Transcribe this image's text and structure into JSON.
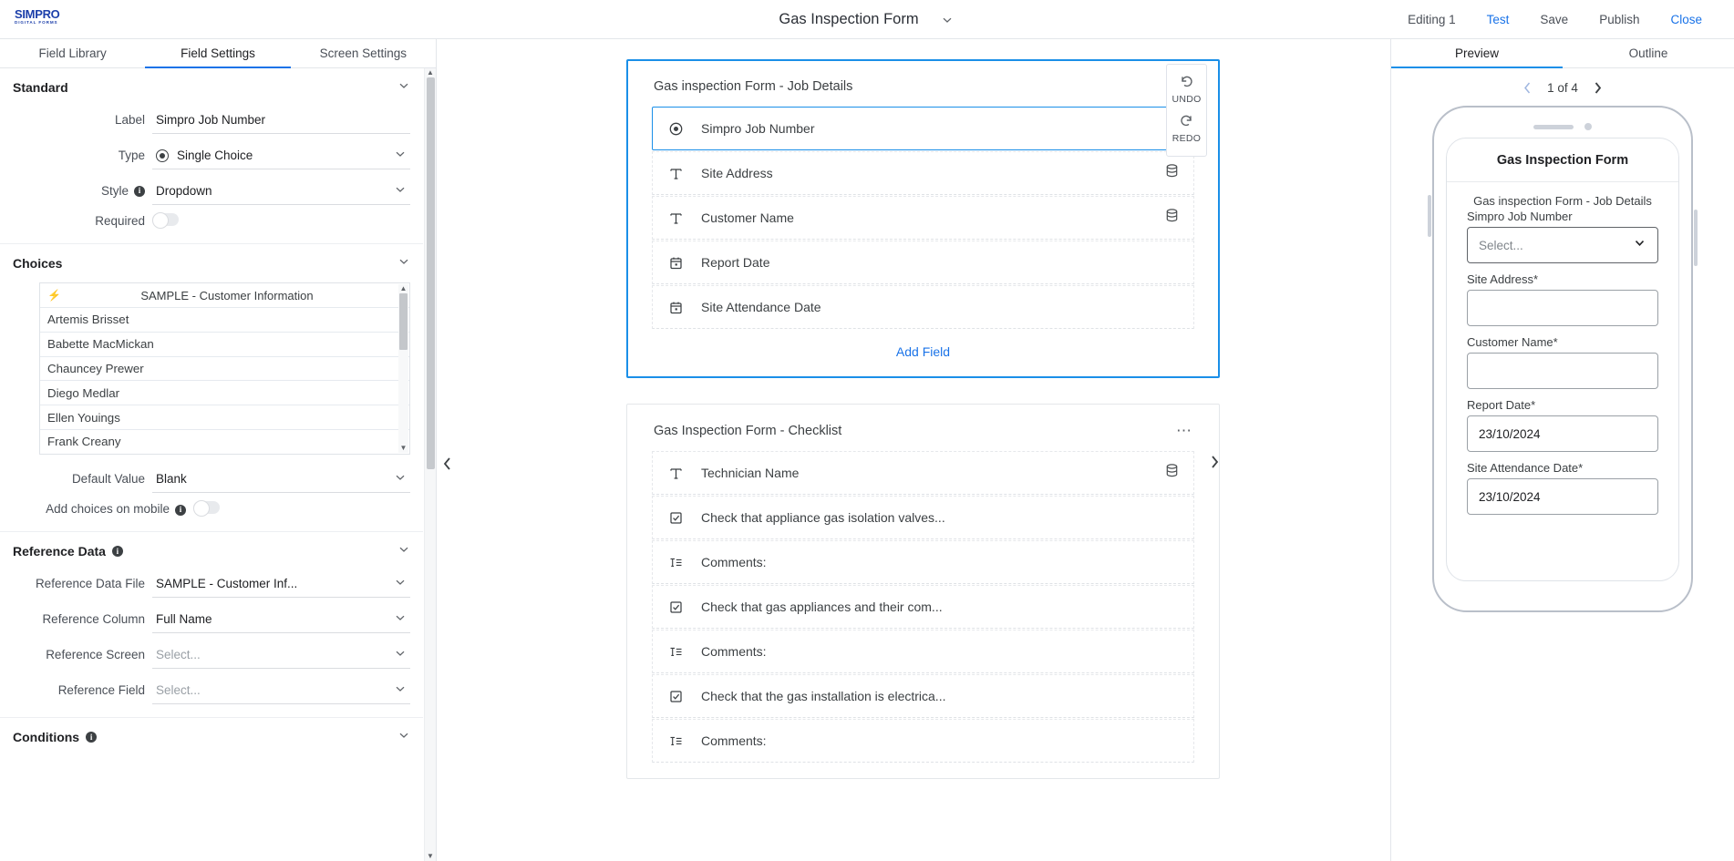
{
  "header": {
    "logo_primary": "SIMPRO",
    "logo_secondary": "DIGITAL FORMS",
    "doc_title": "Gas Inspection Form",
    "actions": [
      {
        "label": "Editing 1",
        "style": "plain"
      },
      {
        "label": "Test",
        "style": "blue"
      },
      {
        "label": "Save",
        "style": "default"
      },
      {
        "label": "Publish",
        "style": "default"
      },
      {
        "label": "Close",
        "style": "blue"
      }
    ]
  },
  "left_panel": {
    "tabs": [
      {
        "label": "Field Library",
        "active": false
      },
      {
        "label": "Field Settings",
        "active": true
      },
      {
        "label": "Screen Settings",
        "active": false
      }
    ],
    "standard": {
      "title": "Standard",
      "label_field": {
        "label": "Label",
        "value": "Simpro Job  Number"
      },
      "type_field": {
        "label": "Type",
        "value": "Single Choice"
      },
      "style_field": {
        "label": "Style",
        "value": "Dropdown"
      },
      "required_field": {
        "label": "Required",
        "value": "off"
      }
    },
    "choices": {
      "title": "Choices",
      "source_title": "SAMPLE - Customer Information",
      "items": [
        "Artemis Brisset",
        "Babette MacMickan",
        "Chauncey Prewer",
        "Diego Medlar",
        "Ellen Youings",
        "Frank Creany"
      ],
      "default_value": {
        "label": "Default Value",
        "value": "Blank"
      },
      "add_on_mobile": {
        "label": "Add choices on mobile",
        "value": "off"
      }
    },
    "reference_data": {
      "title": "Reference Data",
      "file": {
        "label": "Reference Data File",
        "value": "SAMPLE - Customer Inf..."
      },
      "column": {
        "label": "Reference Column",
        "value": "Full Name"
      },
      "screen": {
        "label": "Reference Screen",
        "value": "Select..."
      },
      "field": {
        "label": "Reference Field",
        "value": "Select..."
      }
    },
    "conditions": {
      "title": "Conditions"
    }
  },
  "canvas": {
    "cards": [
      {
        "title": "Gas inspection Form - Job Details",
        "selected": true,
        "add_field_label": "Add Field",
        "fields": [
          {
            "label": "Simpro Job  Number",
            "icon": "radio-icon",
            "has_data": true,
            "active": true
          },
          {
            "label": "Site Address",
            "icon": "text-icon",
            "has_data": true,
            "active": false
          },
          {
            "label": "Customer Name",
            "icon": "text-icon",
            "has_data": true,
            "active": false
          },
          {
            "label": "Report Date",
            "icon": "calendar-icon",
            "has_data": false,
            "active": false
          },
          {
            "label": "Site Attendance Date",
            "icon": "calendar-icon",
            "has_data": false,
            "active": false
          }
        ]
      },
      {
        "title": "Gas Inspection Form - Checklist",
        "selected": false,
        "add_field_label": "",
        "fields": [
          {
            "label": "Technician Name",
            "icon": "text-icon",
            "has_data": true,
            "active": false
          },
          {
            "label": "Check that appliance gas isolation valves...",
            "icon": "checkbox-icon",
            "has_data": false,
            "active": false
          },
          {
            "label": "Comments:",
            "icon": "paragraph-icon",
            "has_data": false,
            "active": false
          },
          {
            "label": "Check that gas appliances and their com...",
            "icon": "checkbox-icon",
            "has_data": false,
            "active": false
          },
          {
            "label": "Comments:",
            "icon": "paragraph-icon",
            "has_data": false,
            "active": false
          },
          {
            "label": "Check that the gas installation is electrica...",
            "icon": "checkbox-icon",
            "has_data": false,
            "active": false
          },
          {
            "label": "Comments:",
            "icon": "paragraph-icon",
            "has_data": false,
            "active": false
          }
        ]
      }
    ]
  },
  "history": {
    "undo_label": "UNDO",
    "redo_label": "REDO"
  },
  "right_panel": {
    "tabs": [
      {
        "label": "Preview",
        "active": true
      },
      {
        "label": "Outline",
        "active": false
      }
    ],
    "pager": "1 of 4",
    "preview": {
      "form_title": "Gas Inspection Form",
      "section_title": "Gas inspection Form - Job Details",
      "fields": [
        {
          "label": "Simpro Job Number",
          "type": "select",
          "value": "Select...",
          "required": false
        },
        {
          "label": "Site Address*",
          "type": "text",
          "value": "",
          "required": true
        },
        {
          "label": "Customer Name*",
          "type": "text",
          "value": "",
          "required": true
        },
        {
          "label": "Report Date*",
          "type": "text",
          "value": "23/10/2024",
          "required": true
        },
        {
          "label": "Site Attendance Date*",
          "type": "text",
          "value": "23/10/2024",
          "required": true
        }
      ]
    }
  },
  "colors": {
    "accent_blue": "#1a73e8",
    "selected_border": "#1a8fe8",
    "brand_blue": "#1c3faa"
  }
}
